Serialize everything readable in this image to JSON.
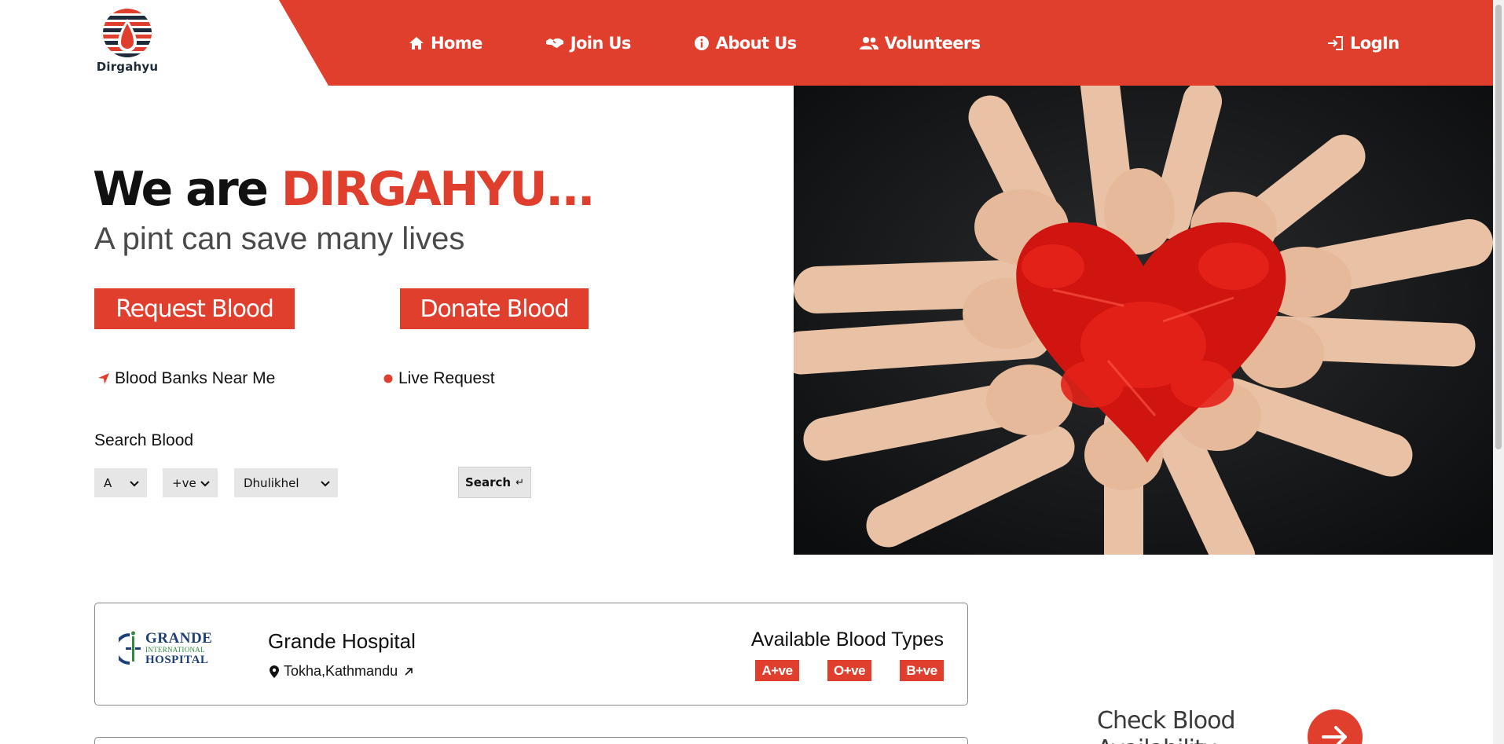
{
  "brand": {
    "name": "Dirgahyu"
  },
  "nav": {
    "items": [
      {
        "label": "Home",
        "icon": "home-icon"
      },
      {
        "label": "Join Us",
        "icon": "handshake-icon"
      },
      {
        "label": "About Us",
        "icon": "info-icon"
      },
      {
        "label": "Volunteers",
        "icon": "users-icon"
      }
    ],
    "login": {
      "label": "LogIn",
      "icon": "login-icon"
    }
  },
  "hero": {
    "title_prefix": "We are ",
    "title_brand": "DIRGAHYU...",
    "subtitle": "A pint can save many lives",
    "request_label": "Request Blood",
    "donate_label": "Donate Blood",
    "banks_link": "Blood Banks Near Me",
    "live_link": "Live Request",
    "image_icon": "painted-hands-image"
  },
  "search": {
    "label": "Search Blood",
    "group_value": "A",
    "rh_value": "+ve",
    "location_value": "Dhulikhel",
    "button_label": "Search",
    "button_glyph": "↵"
  },
  "hospital": {
    "logo": {
      "line1": "GRANDE",
      "line2": "INTERNATIONAL",
      "line3": "HOSPITAL"
    },
    "name": "Grande Hospital",
    "location": "Tokha,Kathmandu",
    "available_title": "Available Blood Types",
    "blood_types": [
      "A+ve",
      "O+ve",
      "B+ve"
    ]
  },
  "check": {
    "line1": "Check Blood",
    "line2": "Availability"
  },
  "colors": {
    "accent": "#e03f2e",
    "text": "#111111",
    "muted": "#4a4a4a"
  }
}
